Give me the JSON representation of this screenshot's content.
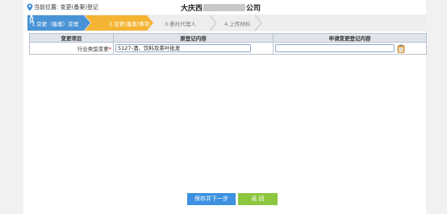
{
  "header": {
    "breadcrumb": "当前位置: 变更(备案)登记",
    "company_prefix": "大庆西",
    "company_suffix": "公司"
  },
  "steps": [
    {
      "label": "1.变更（备案）变理",
      "state": "done"
    },
    {
      "label": "2.变更(备案)事项",
      "state": "current"
    },
    {
      "label": "3.委托代理人",
      "state": "todo"
    },
    {
      "label": "4.上传材料",
      "state": "todo"
    }
  ],
  "table": {
    "headers": [
      "变更项目",
      "原登记内容",
      "申请变更登记内容"
    ],
    "rows": [
      {
        "item": "行业类型变更",
        "required_mark": "*",
        "original": "5127-酒、饮料及茶叶批发",
        "applied": ""
      }
    ]
  },
  "buttons": {
    "save_next": "保存并下一步",
    "back": "返 回"
  },
  "colors": {
    "step_done": "#4a93d6",
    "step_current": "#f4b433",
    "button_save": "#3d91e0",
    "button_back": "#8cc63f"
  },
  "icons": {
    "location": "map-pin-icon",
    "current_step": "bike-icon",
    "picker": "clipboard-icon"
  }
}
